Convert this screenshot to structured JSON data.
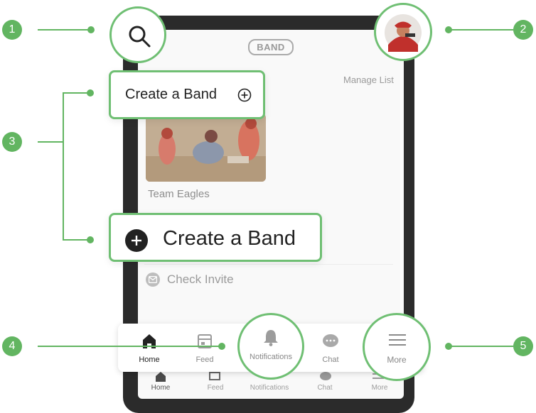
{
  "header": {
    "logo_text": "BAND",
    "manage_list": "Manage List"
  },
  "band_card": {
    "name": "Team Eagles"
  },
  "create_band_small": {
    "label": "Create a Band"
  },
  "create_band_large": {
    "label": "Create a Band"
  },
  "check_invite": {
    "label": "Check Invite"
  },
  "nav": {
    "home": "Home",
    "feed": "Feed",
    "notifications": "Notifications",
    "chat": "Chat",
    "more": "More"
  },
  "callouts": [
    "1",
    "2",
    "3",
    "4",
    "5"
  ],
  "colors": {
    "accent": "#62b561",
    "callout_border": "#6fbf73"
  }
}
